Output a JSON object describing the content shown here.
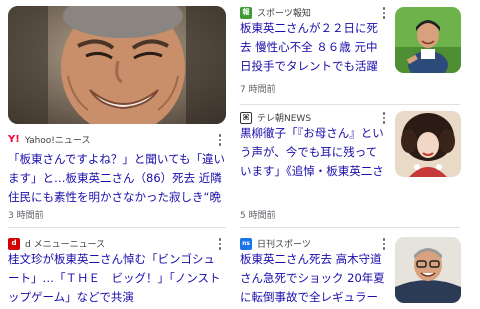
{
  "articles": [
    {
      "source": "Yahoo!ニュース",
      "icon": "yahoo-news-icon",
      "icon_color": "#ff0033",
      "headline": "「板東さんですよね？」と聞いても「違います」と…板東英二さん（86）死去 近隣住民にも素性を明かさなかった寂しき“晩年”",
      "time": "3 時間前"
    },
    {
      "source": "スポーツ報知",
      "icon": "hochi-icon",
      "icon_color": "#3f9a3a",
      "headline": "板東英二さんが２２日に死去 慢性心不全 ８６歳 元中日投手でタレントでも活躍「晩…",
      "time": "7 時間前"
    },
    {
      "source": "テレ朝NEWS",
      "icon": "tvasahi-icon",
      "icon_color": "#333333",
      "headline": "黒柳徹子「『お母さん』という声が、今でも耳に残っています」《追悼・板東英二さん》",
      "time": "5 時間前"
    },
    {
      "source": "d メニューニュース",
      "icon": "dmenu-icon",
      "icon_color": "#d60000",
      "headline": "桂文珍が板東英二さん悼む「ビンゴシュート」…「ＴＨＥ　ビッグ！」「ノンストップゲーム」などで共演",
      "time": ""
    },
    {
      "source": "日刊スポーツ",
      "icon": "nikkan-icon",
      "icon_color": "#1a73e8",
      "headline": "板東英二さん死去 高木守道さん急死でショック 20年夏に転倒事故で全レギュラー終了",
      "time": ""
    }
  ]
}
